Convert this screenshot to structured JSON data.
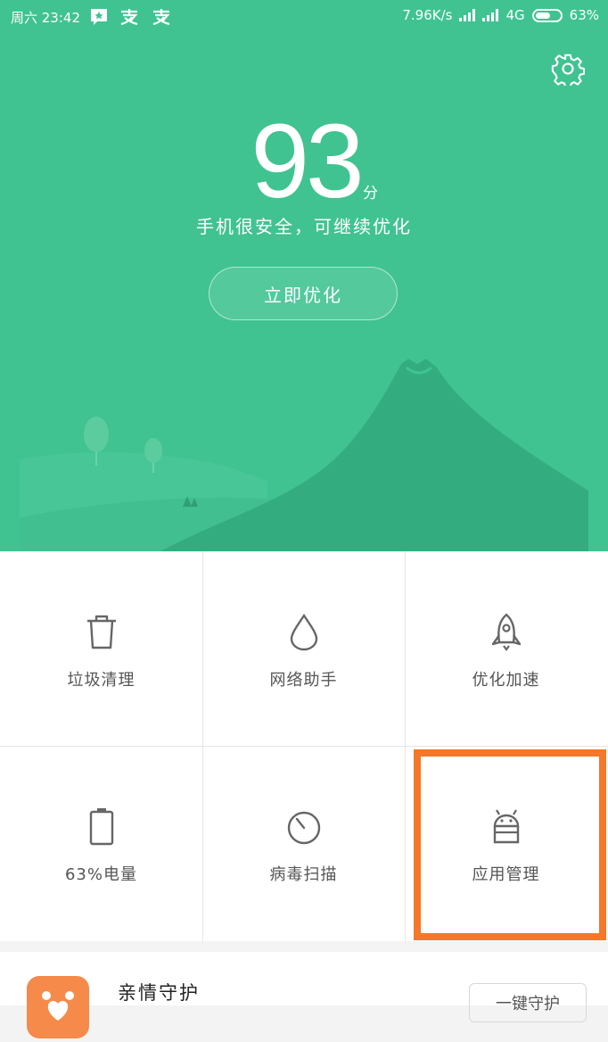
{
  "status_bar": {
    "time": "周六 23:42",
    "network_speed": "7.96K/s",
    "network_type": "4G",
    "battery_percent": "63%",
    "battery_level": 0.63,
    "notification_icons": [
      "app-notification-icon",
      "alipay-icon",
      "alipay-icon"
    ]
  },
  "hero": {
    "score": "93",
    "score_unit": "分",
    "status_text": "手机很安全，可继续优化",
    "optimize_button": "立即优化",
    "background_color": "#40c391",
    "settings_icon": "gear-icon"
  },
  "tools": [
    {
      "label": "垃圾清理",
      "icon": "trash-icon"
    },
    {
      "label": "网络助手",
      "icon": "droplet-icon"
    },
    {
      "label": "优化加速",
      "icon": "rocket-icon"
    },
    {
      "label": "63%电量",
      "icon": "battery-icon"
    },
    {
      "label": "病毒扫描",
      "icon": "scan-dial-icon"
    },
    {
      "label": "应用管理",
      "icon": "android-icon"
    }
  ],
  "highlight_color": "#f4772b",
  "card": {
    "title": "亲情守护",
    "button": "一键守护",
    "icon": "family-guard-icon",
    "icon_color": "#f58a4a"
  }
}
